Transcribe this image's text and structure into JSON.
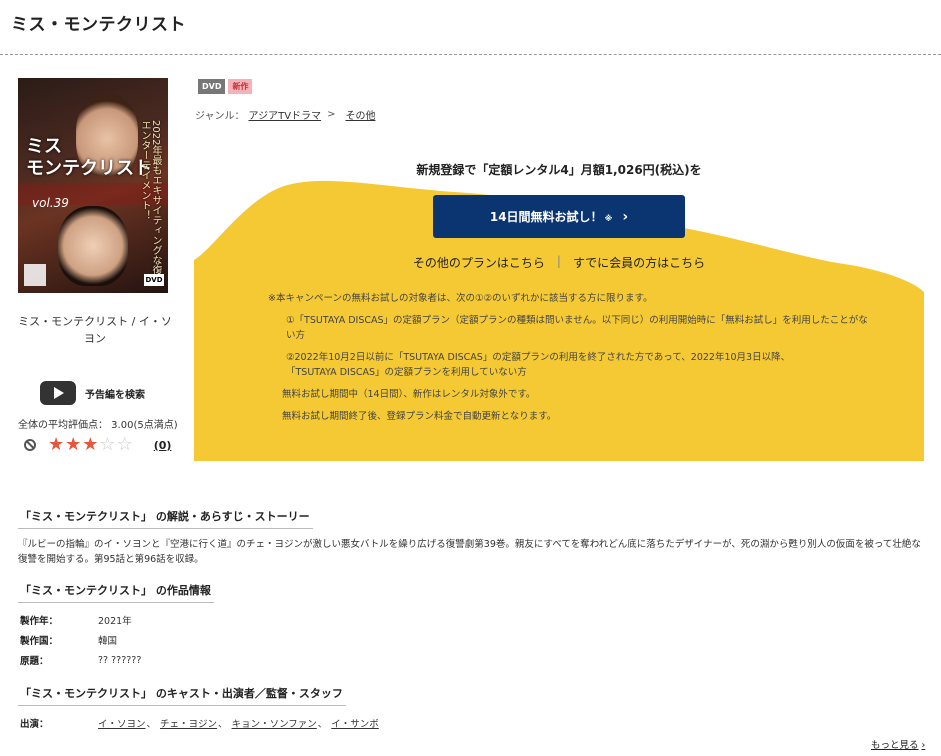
{
  "page": {
    "title": "ミス・モンテクリスト"
  },
  "jacket": {
    "title": "ミス\nモンテクリスト",
    "tagline": "2022年最もエキサイティングな復讐エンターテイメント！",
    "volume": "vol.39",
    "format": "DVD"
  },
  "work": {
    "caption": "ミス・モンテクリスト / イ・ソヨン",
    "trailer_label": "予告編を検索",
    "avg_rating_text": "全体の平均評価点： 3.00(5点満点)",
    "rating": 3,
    "rating_max": 5,
    "review_count": "(0)"
  },
  "badges": {
    "dvd": "DVD",
    "new": "新作"
  },
  "genre": {
    "label": "ジャンル：",
    "path": [
      "アジアTVドラマ",
      "その他"
    ],
    "sep": ">"
  },
  "promo": {
    "headline": "新規登録で「定額レンタル4」月額1,026円(税込)を",
    "cta_label": "14日間無料お試し！",
    "cta_note": "※",
    "cta_chevron": "›",
    "other_plans": "その他のプランはこちら",
    "divider": "|",
    "member_link": "すでに会員の方はこちら",
    "bg_color": "#f5c933",
    "cta_color": "#0a3570",
    "notes": {
      "intro": "※本キャンペーンの無料お試しの対象者は、次の①②のいずれかに該当する方に限ります。",
      "item1": "①「TSUTAYA DISCAS」の定額プラン（定額プランの種類は問いません。以下同じ）の利用開始時に「無料お試し」を利用したことがない方",
      "item2a": "②2022年10月2日以前に「TSUTAYA DISCAS」の定額プランの利用を終了された方であって、2022年10月3日以降、",
      "item2b": "「TSUTAYA DISCAS」の定額プランを利用していない方",
      "line3": "無料お試し期間中（14日間）、新作はレンタル対象外です。",
      "line4": "無料お試し期間終了後、登録プラン料金で自動更新となります。"
    }
  },
  "sections": {
    "story_head": "「ミス・モンテクリスト」 の解説・あらすじ・ストーリー",
    "story_text": "『ルビーの指輪』のイ・ソヨンと『空港に行く道』のチェ・ヨジンが激しい悪女バトルを繰り広げる復讐劇第39巻。親友にすべてを奪われどん底に落ちたデザイナーが、死の淵から甦り別人の仮面を被って壮絶な復讐を開始する。第95話と第96話を収録。",
    "info_head": "「ミス・モンテクリスト」 の作品情報",
    "info": [
      {
        "k": "製作年：",
        "v": "2021年"
      },
      {
        "k": "製作国：",
        "v": "韓国"
      },
      {
        "k": "原題：",
        "v": "?? ??????"
      }
    ],
    "cast_head": "「ミス・モンテクリスト」 のキャスト・出演者／監督・スタッフ",
    "cast_label": "出演：",
    "cast": [
      "イ・ソヨン",
      "チェ・ヨジン",
      "キョン・ソンファン",
      "イ・サンボ"
    ],
    "cast_comma": "、",
    "more": "もっと見る",
    "more_chevron": "›"
  }
}
